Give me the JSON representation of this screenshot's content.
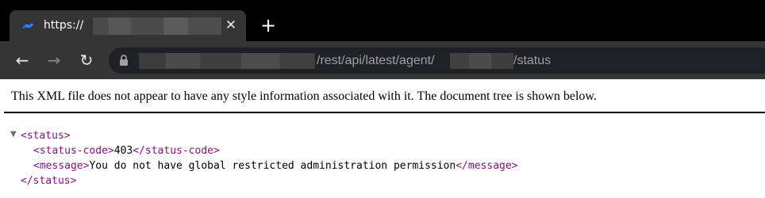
{
  "tab": {
    "title": "https://",
    "close_glyph": "✕",
    "new_tab_glyph": "+",
    "favicon": "confluence-icon",
    "favicon_color": "#1868db"
  },
  "toolbar": {
    "back_glyph": "←",
    "forward_glyph": "→",
    "reload_glyph": "↻",
    "url_segment_1": "/rest/api/latest/agent/",
    "url_segment_2": "/status"
  },
  "content": {
    "info": "This XML file does not appear to have any style information associated with it. The document tree is shown below.",
    "fold_glyph": "▼",
    "xml": {
      "root_open": "<status>",
      "code_open": "<status-code>",
      "code_value": "403",
      "code_close": "</status-code>",
      "msg_open": "<message>",
      "msg_value": "You do not have global restricted administration permission",
      "msg_close": "</message>",
      "root_close": "</status>"
    }
  },
  "colors": {
    "tag": "#881280",
    "tab_bg": "#353535",
    "strip_bg": "#000000",
    "omnibox_bg": "#202124"
  }
}
